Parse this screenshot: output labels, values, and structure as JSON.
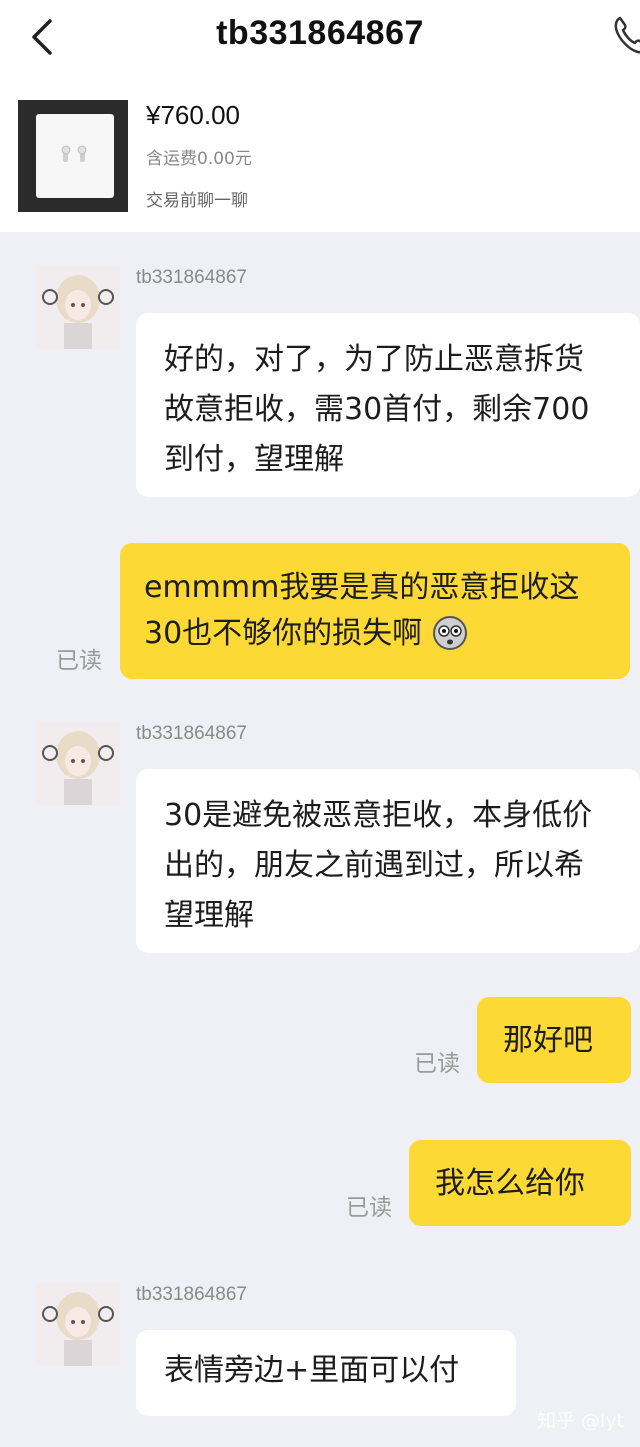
{
  "header": {
    "title": "tb331864867",
    "back_icon": "chevron-left-icon",
    "call_icon": "phone-icon"
  },
  "product": {
    "price": "¥760.00",
    "shipping": "含运费0.00元",
    "chat_prompt": "交易前聊一聊"
  },
  "messages": [
    {
      "direction": "in",
      "sender": "tb331864867",
      "text": "好的，对了，为了防止恶意拆货故意拒收，需30首付，剩余700到付，望理解"
    },
    {
      "direction": "out",
      "status": "已读",
      "text": "emmmm我要是真的恶意拒收这30也不够你的损失啊",
      "emoji": "shocked-face-icon"
    },
    {
      "direction": "in",
      "sender": "tb331864867",
      "text": "30是避免被恶意拒收，本身低价出的，朋友之前遇到过，所以希望理解"
    },
    {
      "direction": "out",
      "status": "已读",
      "text": "那好吧"
    },
    {
      "direction": "out",
      "status": "已读",
      "text": "我怎么给你"
    },
    {
      "direction": "in",
      "sender": "tb331864867",
      "text": "表情旁边+里面可以付"
    }
  ],
  "watermark": "知乎 @lyt",
  "colors": {
    "background": "#eff0f5",
    "outgoing_bubble": "#fdd936",
    "incoming_bubble": "#ffffff"
  }
}
